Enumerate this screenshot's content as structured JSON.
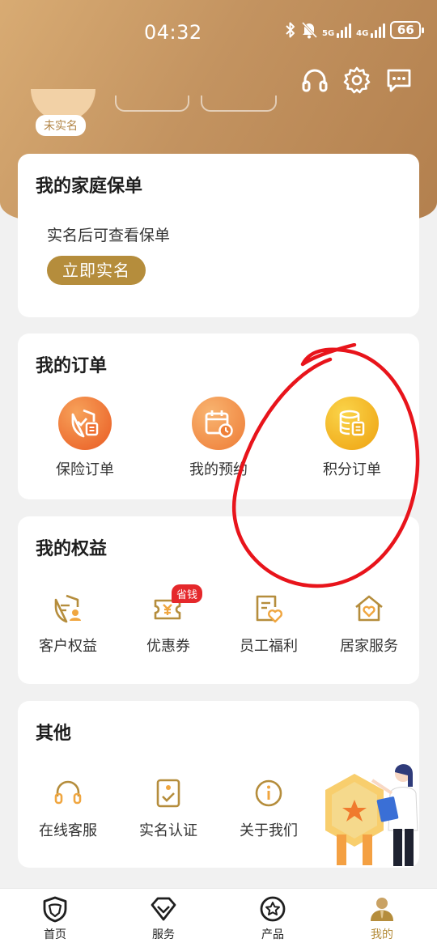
{
  "status_bar": {
    "time": "04:32",
    "network_1": "5G",
    "network_2": "4G",
    "battery": "66"
  },
  "header": {
    "unverified_badge": "未实名",
    "icons": [
      "headset-icon",
      "settings-icon",
      "message-icon"
    ]
  },
  "family_policy": {
    "title": "我的家庭保单",
    "hint": "实名后可查看保单",
    "verify_button": "立即实名"
  },
  "orders": {
    "title": "我的订单",
    "items": [
      {
        "label": "保险订单",
        "icon": "insurance-order-icon",
        "color": "#ee6a2c"
      },
      {
        "label": "我的预约",
        "icon": "appointment-icon",
        "color": "#f08a3c"
      },
      {
        "label": "积分订单",
        "icon": "points-order-icon",
        "color": "#efb31a"
      }
    ]
  },
  "rights": {
    "title": "我的权益",
    "save_badge": "省钱",
    "items": [
      {
        "label": "客户权益",
        "icon": "customer-rights-icon"
      },
      {
        "label": "优惠券",
        "icon": "coupon-icon"
      },
      {
        "label": "员工福利",
        "icon": "employee-benefit-icon"
      },
      {
        "label": "居家服务",
        "icon": "home-service-icon"
      }
    ]
  },
  "other": {
    "title": "其他",
    "items": [
      {
        "label": "在线客服",
        "icon": "headset-icon"
      },
      {
        "label": "实名认证",
        "icon": "verification-icon"
      },
      {
        "label": "关于我们",
        "icon": "info-icon"
      }
    ]
  },
  "tabbar": {
    "items": [
      {
        "label": "首页",
        "icon": "home-shield-icon"
      },
      {
        "label": "服务",
        "icon": "diamond-icon"
      },
      {
        "label": "产品",
        "icon": "star-icon"
      },
      {
        "label": "我的",
        "icon": "person-icon"
      }
    ],
    "active_index": 3
  },
  "colors": {
    "header_gold": "#c39360",
    "accent": "#b58d3c",
    "badge_red": "#e5282b",
    "annotation_red": "#e8141b"
  }
}
